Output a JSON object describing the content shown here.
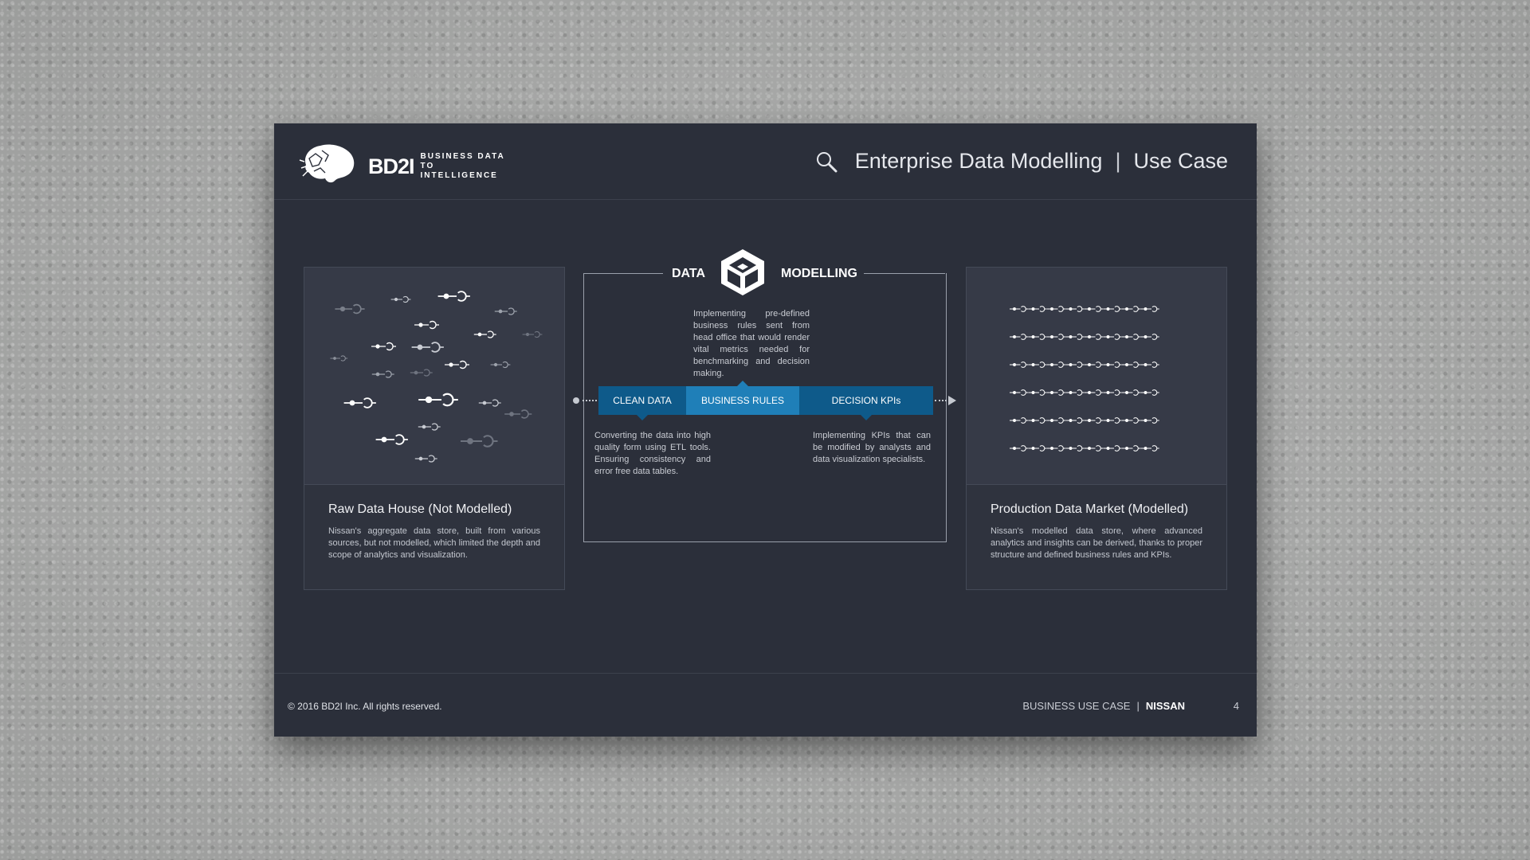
{
  "header": {
    "brand_mark": "BD2I",
    "brand_tag": "BUSINESS DATA TO INTELLIGENCE",
    "title": "Enterprise Data Modelling",
    "separator": "|",
    "subtitle": "Use Case"
  },
  "left_panel": {
    "title": "Raw Data House (Not Modelled)",
    "description": "Nissan's aggregate data store, built from various sources, but not modelled, which limited the depth and scope of analytics and visualization."
  },
  "center": {
    "title_left": "DATA",
    "title_right": "MODELLING",
    "top_text": "Implementing pre-defined business rules sent from head office that would render vital metrics needed for benchmarking and decision making.",
    "steps": [
      "CLEAN DATA",
      "BUSINESS RULES",
      "DECISION KPIs"
    ],
    "left_text": "Converting the data into high quality form using ETL tools. Ensuring consistency and error free data tables.",
    "right_text": "Implementing KPIs that can be modified by analysts and data visualization specialists."
  },
  "right_panel": {
    "title": "Production Data Market (Modelled)",
    "description": "Nissan's modelled data store, where advanced analytics and insights can be derived, thanks to proper structure and defined business rules and KPIs."
  },
  "footer": {
    "copyright": "© 2016 BD2I Inc. All rights reserved.",
    "label": "BUSINESS USE CASE",
    "separator": "|",
    "client": "NISSAN",
    "page": "4"
  },
  "colors": {
    "slide_bg": "#2b2f3a",
    "accent_dark": "#0e5a8a",
    "accent_light": "#1f7fb8"
  }
}
